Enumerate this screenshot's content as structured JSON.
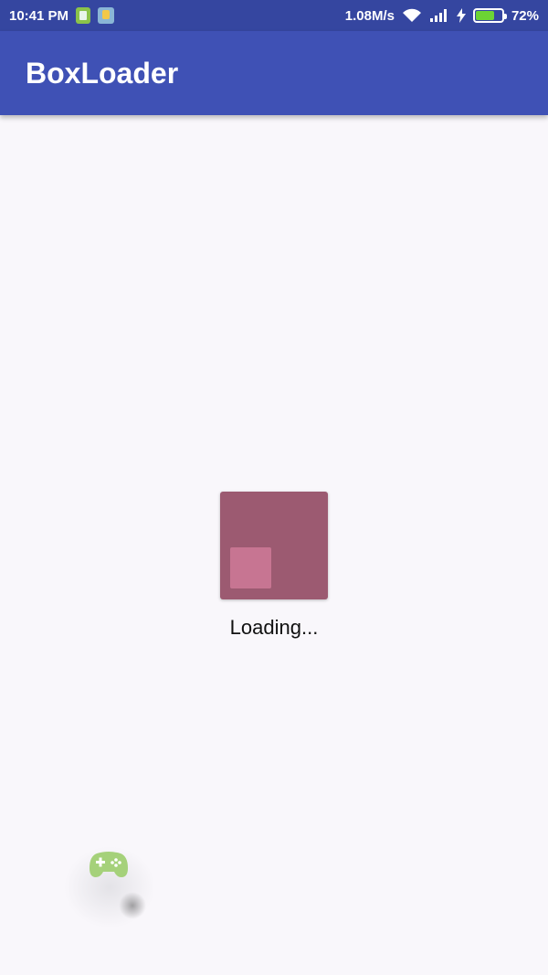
{
  "status_bar": {
    "time": "10:41 PM",
    "network_speed": "1.08M/s",
    "battery_percent": "72%",
    "battery_level": 0.72,
    "icons": [
      "sim-app-icon",
      "app-notification-icon",
      "wifi-icon",
      "signal-icon",
      "charging-bolt-icon",
      "battery-icon"
    ]
  },
  "app_bar": {
    "title": "BoxLoader",
    "color": "#3f51b5"
  },
  "loader": {
    "label": "Loading...",
    "outer_color": "#9c5a71",
    "inner_color": "#c77592"
  },
  "floating_widget": {
    "icon": "gamepad-icon",
    "color": "#8bc34a"
  }
}
